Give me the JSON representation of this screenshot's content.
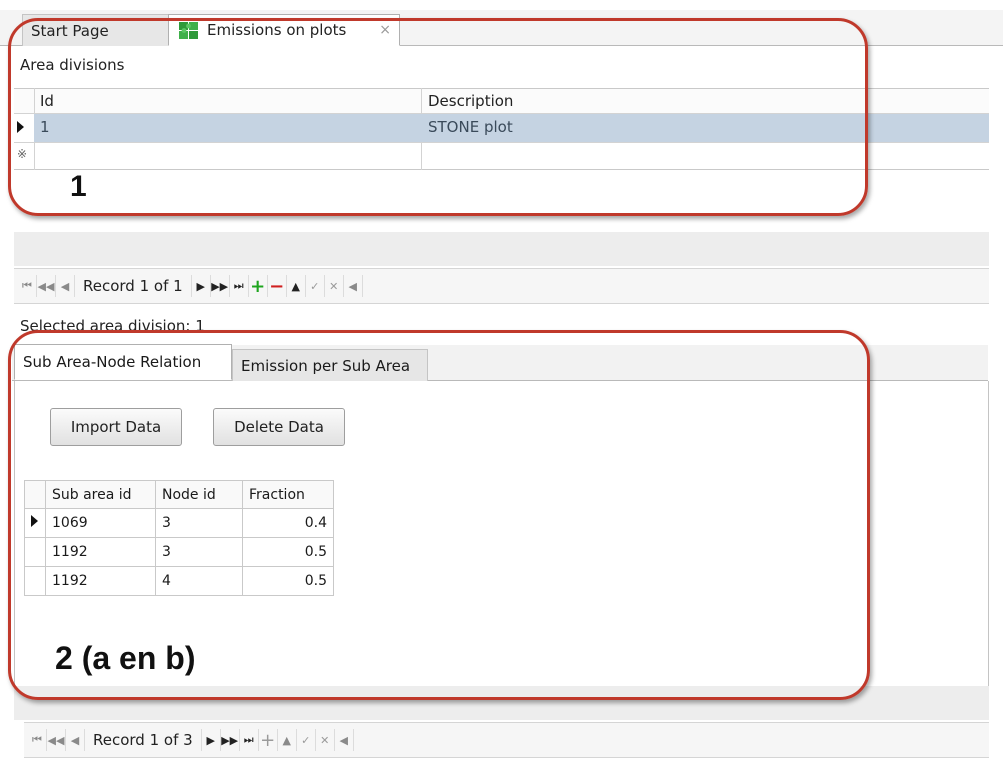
{
  "tabs": [
    {
      "label": "Start Page",
      "icon": "none"
    },
    {
      "label": "Emissions on plots",
      "icon": "puzzle-icon",
      "close": "×"
    }
  ],
  "area_divisions": {
    "title": "Area divisions",
    "columns": [
      "Id",
      "Description"
    ],
    "rows": [
      {
        "id": "1",
        "description": "STONE plot"
      }
    ],
    "new_row_marker": "※",
    "navigator": {
      "record_text": "Record 1 of 1"
    }
  },
  "selected_area_label": "Selected area division: 1",
  "subtabs": [
    {
      "label": "Sub Area-Node Relation"
    },
    {
      "label": "Emission per Sub Area"
    }
  ],
  "buttons": {
    "import": "Import Data",
    "delete": "Delete Data"
  },
  "relation_table": {
    "columns": [
      "Sub area id",
      "Node id",
      "Fraction"
    ],
    "rows": [
      {
        "sub_area_id": "1069",
        "node_id": "3",
        "fraction": "0.4"
      },
      {
        "sub_area_id": "1192",
        "node_id": "3",
        "fraction": "0.5"
      },
      {
        "sub_area_id": "1192",
        "node_id": "4",
        "fraction": "0.5"
      }
    ],
    "navigator": {
      "record_text": "Record 1 of 3"
    }
  },
  "annotations": {
    "one": "1",
    "two": "2 (a en b)",
    "color": "#c0392b"
  },
  "colors": {
    "selected_row": "#c5d3e2",
    "add": "#1ea51e",
    "remove": "#d01f1f"
  }
}
